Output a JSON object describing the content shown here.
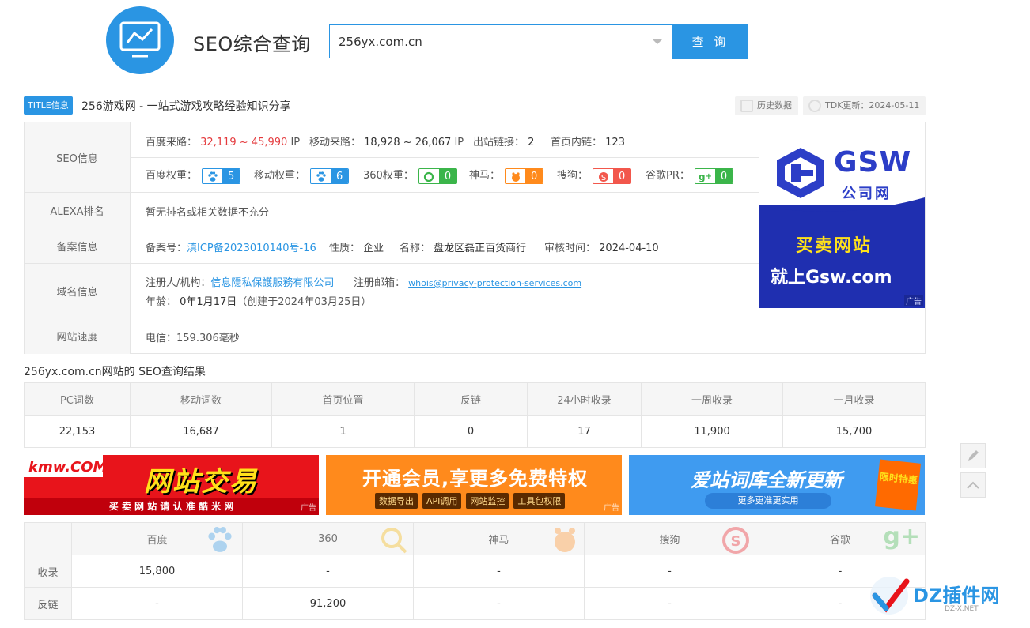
{
  "header": {
    "brand": "SEO综合查询",
    "search_value": "256yx.com.cn",
    "search_button": "查 询"
  },
  "title_row": {
    "badge": "TITLE信息",
    "title": "256游戏网 - 一站式游戏攻略经验知识分享",
    "history": "历史数据",
    "tdk": "TDK更新：2024-05-11"
  },
  "seo": {
    "label": "SEO信息",
    "baidu_traffic_label": "百度来路：",
    "baidu_traffic": "32,119 ~ 45,990",
    "ip1": "IP",
    "mobile_traffic_label": "移动来路：",
    "mobile_traffic": "18,928 ~ 26,067",
    "ip2": "IP",
    "outlinks_label": "出站链接：",
    "outlinks": "2",
    "homelinks_label": "首页内链：",
    "homelinks": "123",
    "baidu_weight_label": "百度权重：",
    "baidu_weight": "5",
    "mobile_weight_label": "移动权重：",
    "mobile_weight": "6",
    "w360_label": "360权重：",
    "w360": "0",
    "shenma_label": "神马：",
    "shenma": "0",
    "sogou_label": "搜狗：",
    "sogou": "0",
    "google_label": "谷歌PR：",
    "google": "0"
  },
  "alexa": {
    "label": "ALEXA排名",
    "value": "暂无排名或相关数据不充分"
  },
  "icp": {
    "label": "备案信息",
    "no_label": "备案号：",
    "no": "滇ICP备2023010140号-16",
    "nature_label": "性质：",
    "nature": "企业",
    "name_label": "名称：",
    "name": "盘龙区磊正百货商行",
    "date_label": "审核时间：",
    "date": "2024-04-10"
  },
  "domain": {
    "label": "域名信息",
    "registrant_label": "注册人/机构：",
    "registrant": "信息隱私保護服務有限公司",
    "email_label": "注册邮箱：",
    "email": "whois@privacy-protection-services.com",
    "age_label": "年龄：",
    "age": "0年1月17日",
    "created": "（创建于2024年03月25日）"
  },
  "speed": {
    "label": "网站速度",
    "value": "电信：159.306毫秒"
  },
  "ad_right": {
    "brand": "GSW",
    "sub": "公司网",
    "line1": "买卖网站",
    "line2": "就上Gsw.com",
    "tag": "广告"
  },
  "results_title": "256yx.com.cn网站的 SEO查询结果",
  "results": {
    "headers": [
      "PC词数",
      "移动词数",
      "首页位置",
      "反链",
      "24小时收录",
      "一周收录",
      "一月收录"
    ],
    "values": [
      "22,153",
      "16,687",
      "1",
      "0",
      "17",
      "11,900",
      "15,700"
    ]
  },
  "banners": [
    {
      "logo": "kmw.COM",
      "title": "网站交易",
      "sub": "买 卖 网 站 请 认 准 酷 米 网",
      "tag": "广告"
    },
    {
      "title": "开通会员,享更多免费特权",
      "chips": [
        "数据导出",
        "API调用",
        "网站监控",
        "工具包权限"
      ],
      "tag": "广告"
    },
    {
      "title": "爱站词库全新更新",
      "sub": "更多更准更实用",
      "badge": "限时特惠",
      "tag": "广告"
    }
  ],
  "engines": {
    "headers": [
      "百度",
      "360",
      "神马",
      "搜狗",
      "谷歌"
    ],
    "rows": [
      {
        "label": "收录",
        "values": [
          "15,800",
          "-",
          "-",
          "-",
          "-"
        ]
      },
      {
        "label": "反链",
        "values": [
          "-",
          "91,200",
          "-",
          "-",
          "-"
        ]
      }
    ]
  },
  "watermark": {
    "text": "DZ插件网",
    "sub": "DZ-X.NET"
  },
  "colors": {
    "accent": "#2a95e3",
    "red": "#e4393c",
    "green": "#3bb54a",
    "orange": "#ff8a1c",
    "gsw_blue": "#1f2fb0"
  }
}
